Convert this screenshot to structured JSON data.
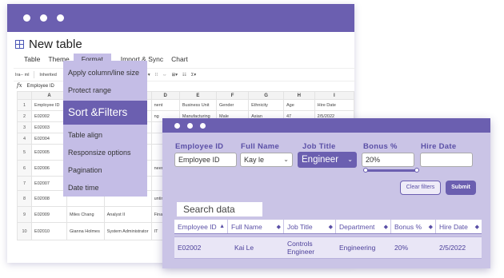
{
  "back_window": {
    "title": "New table",
    "menu": [
      "Table",
      "Theme",
      "Format",
      "Import & Sync",
      "Chart"
    ],
    "active_menu": "Format",
    "toolbar": [
      "Ira-- ml",
      "Inherited",
      "A",
      "≡▾",
      "⊥▾",
      "⊩▾",
      "⁝⁝",
      "⇔",
      "⊞▾",
      "☷",
      "Σ▾"
    ],
    "formula_bar": {
      "fx": "fx",
      "cell_value": "Employee ID"
    },
    "sheet": {
      "columns": [
        "",
        "A",
        "B",
        "C",
        "D",
        "E",
        "F",
        "G",
        "H",
        "I"
      ],
      "rows": [
        [
          "1",
          "Employee ID",
          "",
          "",
          "nent",
          "Business Unit",
          "Gender",
          "Ethnicity",
          "Age",
          "Hire Date"
        ],
        [
          "2",
          "E02002",
          "",
          "",
          "ng",
          "Manufacturing",
          "Male",
          "Asian",
          "47",
          "2/5/2022"
        ],
        [
          "3",
          "E02003",
          "",
          "",
          "",
          "",
          "",
          "",
          "",
          ""
        ],
        [
          "4",
          "E02004",
          "",
          "",
          "",
          "",
          "",
          "",
          "",
          ""
        ],
        [
          "5",
          "E02005",
          "",
          "",
          "",
          "",
          "",
          "",
          "",
          ""
        ],
        [
          "6",
          "E02006",
          "",
          "",
          "neering",
          "",
          "",
          "",
          "",
          ""
        ],
        [
          "7",
          "E02007",
          "",
          "",
          "",
          "",
          "",
          "",
          "",
          ""
        ],
        [
          "8",
          "E02008",
          "",
          "",
          "unting",
          "",
          "",
          "",
          "",
          ""
        ],
        [
          "9",
          "E02009",
          "Miles Chang",
          "Analyst II",
          "Finance",
          "",
          "",
          "",
          "",
          ""
        ],
        [
          "10",
          "E02010",
          "Gianna Holmes",
          "System Administrator",
          "IT",
          "",
          "",
          "",
          "",
          ""
        ]
      ]
    },
    "format_menu": [
      "Apply column/line size",
      "Protect range",
      "Sort &Filters",
      "Table align",
      "Responsize options",
      "Pagination",
      "Date time"
    ],
    "format_menu_selected": "Sort &Filters"
  },
  "filter_window": {
    "labels": {
      "employee_id": "Employee ID",
      "full_name": "Full Name",
      "job_title": "Job Title",
      "bonus": "Bonus %",
      "hire_date": "Hire Date"
    },
    "values": {
      "employee_id": "Employee ID",
      "full_name": "Kay le",
      "job_title": "Engineer",
      "bonus": "20%",
      "hire_date": ""
    },
    "buttons": {
      "clear": "Clear filters",
      "submit": "Submit"
    },
    "search_placeholder": "Search data",
    "results": {
      "headers": [
        "Employee ID",
        "Full Name",
        "Job Title",
        "Department",
        "Bonus %",
        "Hire Date"
      ],
      "rows": [
        [
          "E02002",
          "Kai Le",
          "Controls Engineer",
          "Engineering",
          "20%",
          "2/5/2022"
        ]
      ]
    },
    "colors": {
      "accent": "#6b5fb0",
      "panel": "#cac4e6",
      "menu": "#c4bde6"
    }
  }
}
